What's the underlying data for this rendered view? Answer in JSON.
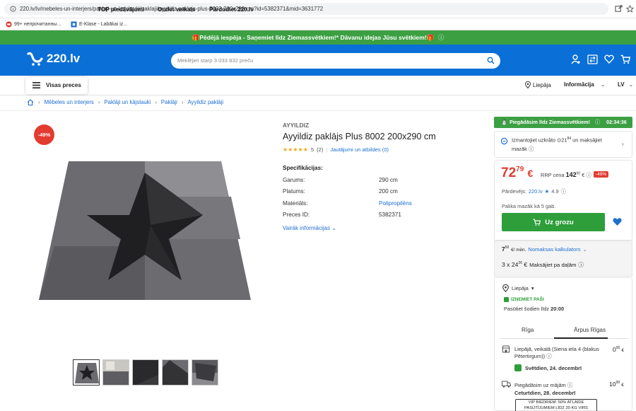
{
  "browser": {
    "url": "220.lv/lv/mebeles-un-interjers/paklaji-un-kajslauki/paklaji/ayyildiz-paklajs-plus-8002-200x290-cm?id=5382371&mid=3631772",
    "bookmark1": "99+ непрочитанны...",
    "bookmark2": "E-Klase - Labākai iz..."
  },
  "promo": {
    "text": "🎁Pēdējā iespēja - Saņemiet līdz Ziemassvētkiem!* Dāvanu idejas Jūsu svētkiem!🎁"
  },
  "header": {
    "logo": "220.lv",
    "search_placeholder": "Meklējiet starp 3 033 832 preču"
  },
  "nav": {
    "all_goods": "Visas preces",
    "items": [
      "TOP piedāvājumi",
      "Outlet veikals",
      "Pārdodiet 220.lv"
    ],
    "city": "Liepāja",
    "info": "Informācija",
    "lang": "LV"
  },
  "breadcrumb": [
    "Mēbeles un interjers",
    "Paklāji un kājslauki",
    "Paklāji",
    "Ayyildiz paklāji"
  ],
  "product": {
    "discount_badge": "-49%",
    "brand": "AYYILDIZ",
    "title": "Ayyildiz paklājs Plus 8002 200x290 cm",
    "stars": "★★★★★",
    "rating": "5",
    "reviews": "(2)",
    "qa_link": "Jautājumi un atbildes (0)",
    "specs_title": "Specifikācijas:",
    "specs": [
      {
        "label": "Garums:",
        "value": "290 cm"
      },
      {
        "label": "Platums:",
        "value": "200 cm"
      },
      {
        "label": "Materiāls:",
        "value": "Polipropilēns"
      },
      {
        "label": "Preces ID:",
        "value": "5382371"
      }
    ],
    "more_info": "Vairāk informācijas"
  },
  "buybox": {
    "delivery_banner": "Piegādāsim līdz Ziemassvētkiem!",
    "timer": "02:34:36",
    "bonus_line1": "Izmantojiet uzkrāto",
    "bonus_amount": "21",
    "bonus_cents": "84",
    "bonus_line2": "un maksājiet",
    "bonus_line3": "mazāk",
    "price_int": "72",
    "price_cents": "79",
    "currency": "€",
    "rrp_label": "RRP cena",
    "rrp_int": "142",
    "rrp_cents": "90",
    "rrp_currency": "€",
    "rrp_pct": "-49%",
    "seller_label": "Pārdevējs:",
    "seller": "220.lv",
    "seller_rating": "4.9",
    "stock": "Palika mazāk kā 5 gab.",
    "cart_button": "Uz grozu",
    "monthly_int": "7",
    "monthly_cents": "50",
    "monthly_unit": "€/ mēn.",
    "calc_link": "Nomaksas kalkulators",
    "split_prefix": "3 x 24",
    "split_cents": "26",
    "split_currency": "€",
    "split_label": "Maksājiet pa daļām"
  },
  "delivery": {
    "city": "Liepāja",
    "pickup_tag": "IZŅEMIET PAŠI",
    "order_today": "Pasūtiet šodien līdz",
    "order_time": "20:00",
    "tab1": "Rīga",
    "tab2": "Ārpus Rīgas",
    "opt1_title": "Liepājā, veikalā (Siena iela 4 (blakus",
    "opt1_title2": "Pētertirgum))",
    "opt1_price_int": "0",
    "opt1_price_cents": "00",
    "opt1_currency": "€",
    "opt1_date": "Svētdien, 24. decembrī",
    "opt2_title": "Piegādāsim uz mājām",
    "opt2_date": "Ceturtdien, 28. decembrī",
    "opt2_price_int": "10",
    "opt2_price_cents": "99",
    "opt2_currency": "€",
    "vip_line1": "VIP BIEDRIEM: 50% ATLAIDE",
    "vip_line2": "PASŪTĪJUMIEM LĪDZ 20 KG VIRS"
  }
}
